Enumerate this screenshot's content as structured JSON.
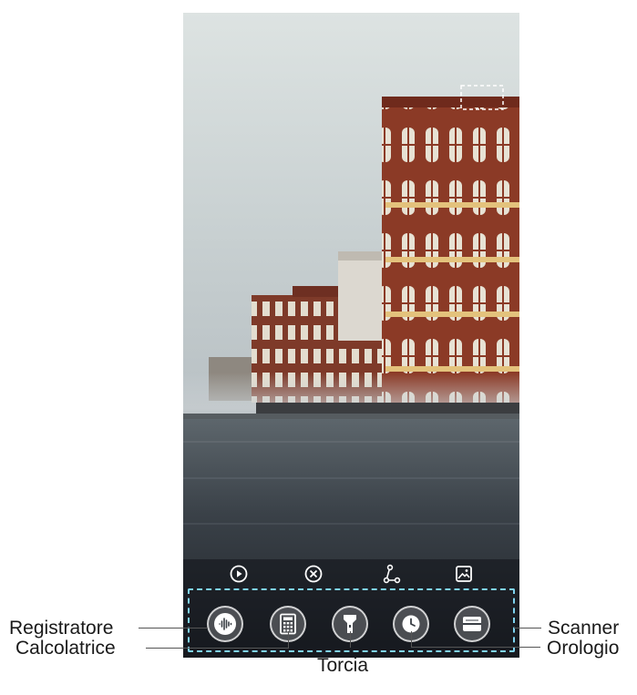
{
  "quick_actions": [
    {
      "icon": "play-icon"
    },
    {
      "icon": "close-circle-icon"
    },
    {
      "icon": "share-icon"
    },
    {
      "icon": "image-icon"
    }
  ],
  "shortcuts": [
    {
      "icon": "recorder-icon"
    },
    {
      "icon": "calculator-icon"
    },
    {
      "icon": "flashlight-icon"
    },
    {
      "icon": "clock-icon"
    },
    {
      "icon": "scanner-icon"
    }
  ],
  "callouts": {
    "registratore": "Registratore",
    "calcolatrice": "Calcolatrice",
    "torcia": "Torcia",
    "orologio": "Orologio",
    "scanner": "Scanner"
  },
  "colors": {
    "dash": "#7fd3f0",
    "sky": "#c9d2d6",
    "brick": "#8a3b28",
    "water": "#2b3038"
  }
}
